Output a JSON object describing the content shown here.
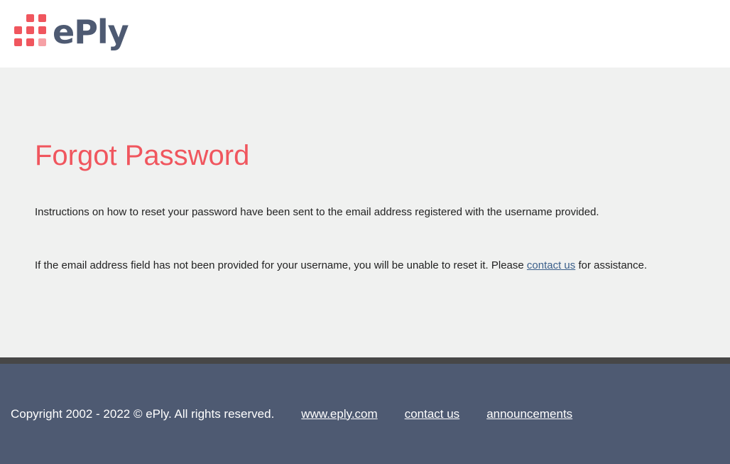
{
  "brand": {
    "name": "ePly",
    "primary_color": "#f0565e",
    "dark_color": "#4e5a72",
    "light_dot_color": "#f6a1a6"
  },
  "main": {
    "title": "Forgot Password",
    "instructions": "Instructions on how to reset your password have been sent to the email address registered with the username provided.",
    "note_prefix": "If the email address field has not been provided for your username, you will be unable to reset it. Please ",
    "note_link": "contact us",
    "note_suffix": " for assistance.",
    "link_color": "#3b5f8a"
  },
  "footer": {
    "copyright": "Copyright 2002 - 2022 © ePly. All rights reserved.",
    "links": [
      "www.eply.com",
      "contact us",
      "announcements"
    ],
    "bg_color": "#4e5a72"
  }
}
